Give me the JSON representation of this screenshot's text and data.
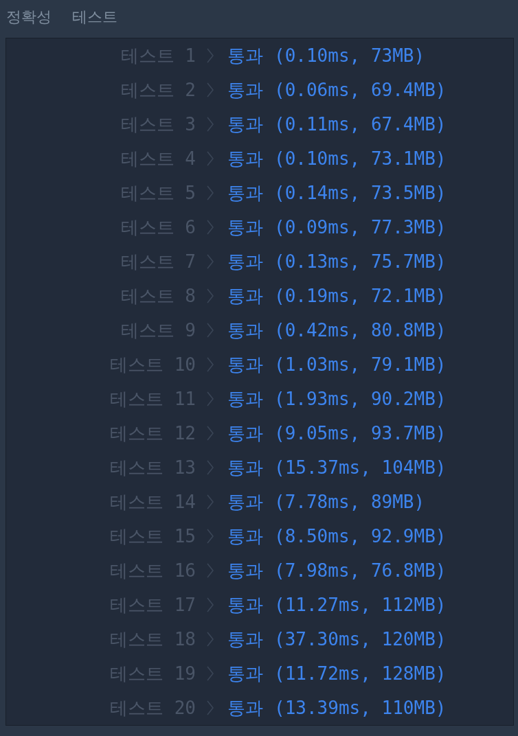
{
  "header": {
    "title": "정확성",
    "subtitle": "테스트"
  },
  "tests": [
    {
      "label": "테스트 1",
      "status": "통과",
      "result": "(0.10ms, 73MB)"
    },
    {
      "label": "테스트 2",
      "status": "통과",
      "result": "(0.06ms, 69.4MB)"
    },
    {
      "label": "테스트 3",
      "status": "통과",
      "result": "(0.11ms, 67.4MB)"
    },
    {
      "label": "테스트 4",
      "status": "통과",
      "result": "(0.10ms, 73.1MB)"
    },
    {
      "label": "테스트 5",
      "status": "통과",
      "result": "(0.14ms, 73.5MB)"
    },
    {
      "label": "테스트 6",
      "status": "통과",
      "result": "(0.09ms, 77.3MB)"
    },
    {
      "label": "테스트 7",
      "status": "통과",
      "result": "(0.13ms, 75.7MB)"
    },
    {
      "label": "테스트 8",
      "status": "통과",
      "result": "(0.19ms, 72.1MB)"
    },
    {
      "label": "테스트 9",
      "status": "통과",
      "result": "(0.42ms, 80.8MB)"
    },
    {
      "label": "테스트 10",
      "status": "통과",
      "result": "(1.03ms, 79.1MB)"
    },
    {
      "label": "테스트 11",
      "status": "통과",
      "result": "(1.93ms, 90.2MB)"
    },
    {
      "label": "테스트 12",
      "status": "통과",
      "result": "(9.05ms, 93.7MB)"
    },
    {
      "label": "테스트 13",
      "status": "통과",
      "result": "(15.37ms, 104MB)"
    },
    {
      "label": "테스트 14",
      "status": "통과",
      "result": "(7.78ms, 89MB)"
    },
    {
      "label": "테스트 15",
      "status": "통과",
      "result": "(8.50ms, 92.9MB)"
    },
    {
      "label": "테스트 16",
      "status": "통과",
      "result": "(7.98ms, 76.8MB)"
    },
    {
      "label": "테스트 17",
      "status": "통과",
      "result": "(11.27ms, 112MB)"
    },
    {
      "label": "테스트 18",
      "status": "통과",
      "result": "(37.30ms, 120MB)"
    },
    {
      "label": "테스트 19",
      "status": "통과",
      "result": "(11.72ms, 128MB)"
    },
    {
      "label": "테스트 20",
      "status": "통과",
      "result": "(13.39ms, 110MB)"
    }
  ]
}
